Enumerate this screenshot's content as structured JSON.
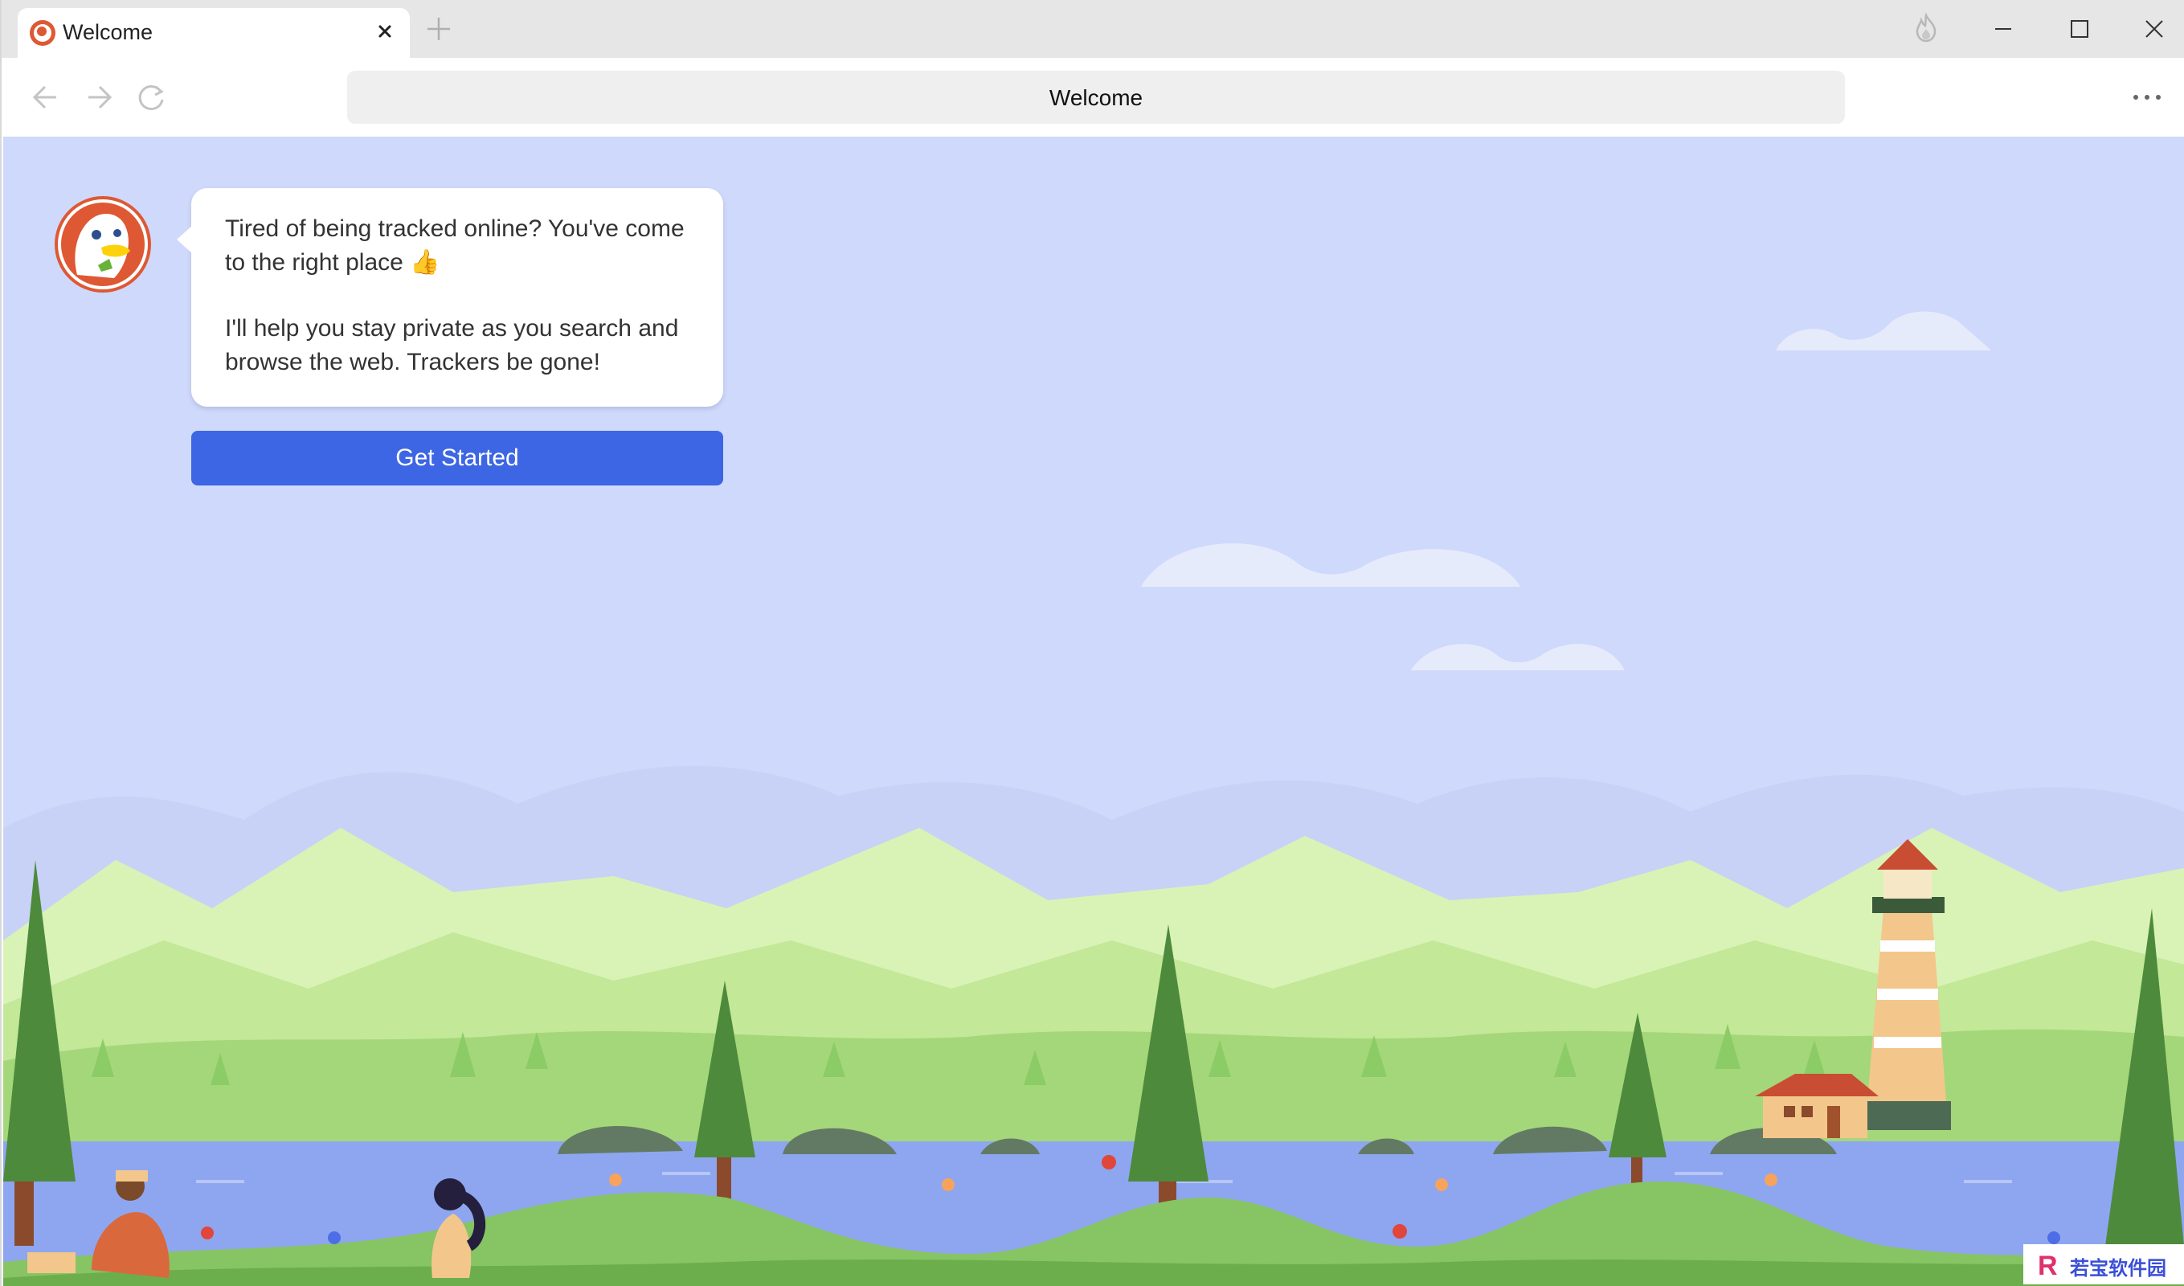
{
  "window": {
    "tab_title": "Welcome",
    "tab_close_icon": "close-icon",
    "new_tab_icon": "plus-icon",
    "fire_icon": "fire-icon"
  },
  "toolbar": {
    "address_text": "Welcome"
  },
  "welcome": {
    "message_line1": "Tired of being tracked online?  You've come to the right place 👍",
    "message_line2": "I'll help you stay private as you search and browse the web. Trackers be gone!",
    "cta_label": "Get Started"
  },
  "watermark": {
    "text": "若宝软件园"
  },
  "colors": {
    "sky": "#cfd9fb",
    "accent": "#3d66e4",
    "duck_orange": "#de5833"
  }
}
